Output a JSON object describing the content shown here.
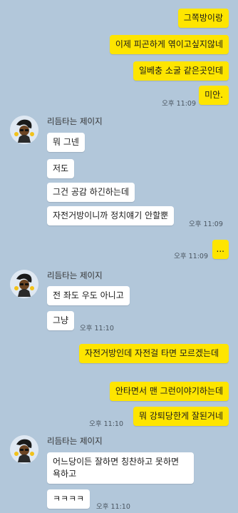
{
  "chat": {
    "sender_name": "리듬타는 제이지",
    "messages": [
      {
        "text": "그쪽방이랑"
      },
      {
        "text": "이제 피곤하게 엮이고싶지않네"
      },
      {
        "text": "일베충 소굴 같은곳인데"
      },
      {
        "text": "미안.",
        "time": "오후 11:09"
      },
      {
        "text": "뭐 그넨"
      },
      {
        "text": "저도"
      },
      {
        "text": "그건 공감 하긴하는데"
      },
      {
        "text": "자전거방이니까 정치얘기 안할뿐",
        "time": "오후 11:09"
      },
      {
        "text": "...",
        "time": "오후 11:09"
      },
      {
        "text": "전 좌도 우도 아니고"
      },
      {
        "text": "그냥",
        "time": "오후 11:10"
      },
      {
        "text": "자전거방인데 자전걸 타면 모르겠는데"
      },
      {
        "text": "안타면서 맨 그런이야기하는데"
      },
      {
        "text": "뭐 강퇴당한게 잘된거네",
        "time": "오후 11:10"
      },
      {
        "text": "어느당이든 잘하면 칭찬하고 못하면 욕하고"
      },
      {
        "text": "ㅋㅋㅋㅋ",
        "time": "오후 11:10"
      }
    ]
  },
  "colors": {
    "background": "#b2c7da",
    "my_bubble": "#fee500",
    "their_bubble": "#ffffff"
  },
  "icons": {
    "avatar": "profile-photo-icon"
  }
}
